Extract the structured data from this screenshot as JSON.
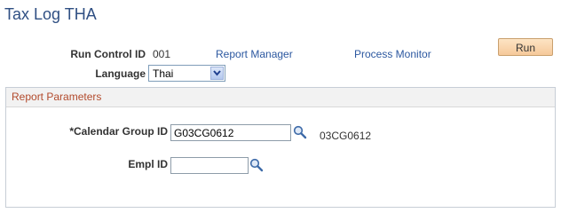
{
  "page": {
    "title": "Tax Log THA"
  },
  "run_control": {
    "label": "Run Control ID",
    "value": "001",
    "report_manager_link": "Report Manager",
    "process_monitor_link": "Process Monitor",
    "run_button": "Run"
  },
  "language": {
    "label": "Language",
    "selected": "Thai"
  },
  "parameters": {
    "section_title": "Report Parameters",
    "calendar_group": {
      "label": "*Calendar Group ID",
      "value": "G03CG0612",
      "description": "03CG0612"
    },
    "empl_id": {
      "label": "Empl ID",
      "value": ""
    }
  },
  "icons": {
    "lookup": "magnifying-glass-icon",
    "dropdown": "chevron-down-icon"
  }
}
